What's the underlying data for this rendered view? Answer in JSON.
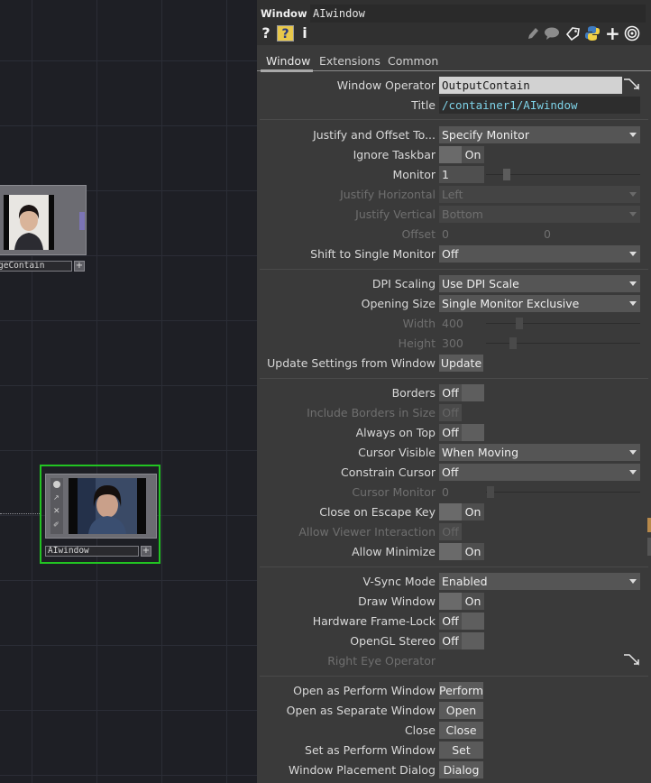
{
  "network": {
    "node_left_label": "geContain",
    "node_ai_label": "AIwindow",
    "plus_glyph": "+"
  },
  "header": {
    "op_type": "Window",
    "op_name": "AIwindow",
    "icons": [
      "help-icon",
      "python-help-icon",
      "info-icon",
      "edit-icon",
      "comment-icon",
      "tag-icon",
      "python-icon",
      "add-icon",
      "target-icon"
    ]
  },
  "tabs": [
    "Window",
    "Extensions",
    "Common"
  ],
  "params": {
    "window_operator": {
      "label": "Window Operator",
      "value": "OutputContain"
    },
    "title": {
      "label": "Title",
      "value": "/container1/AIwindow"
    },
    "justify_offset": {
      "label": "Justify and Offset To...",
      "value": "Specify Monitor"
    },
    "ignore_taskbar": {
      "label": "Ignore Taskbar",
      "value": "On"
    },
    "monitor": {
      "label": "Monitor",
      "value": "1"
    },
    "justify_h": {
      "label": "Justify Horizontal",
      "value": "Left"
    },
    "justify_v": {
      "label": "Justify Vertical",
      "value": "Bottom"
    },
    "offset": {
      "label": "Offset",
      "x": "0",
      "y": "0"
    },
    "shift_single": {
      "label": "Shift to Single Monitor",
      "value": "Off"
    },
    "dpi_scaling": {
      "label": "DPI Scaling",
      "value": "Use DPI Scale"
    },
    "opening_size": {
      "label": "Opening Size",
      "value": "Single Monitor Exclusive"
    },
    "width": {
      "label": "Width",
      "value": "400"
    },
    "height": {
      "label": "Height",
      "value": "300"
    },
    "update_settings": {
      "label": "Update Settings from Window",
      "button": "Update"
    },
    "borders": {
      "label": "Borders",
      "value": "Off"
    },
    "include_borders": {
      "label": "Include Borders in Size",
      "value": "Off"
    },
    "always_on_top": {
      "label": "Always on Top",
      "value": "Off"
    },
    "cursor_visible": {
      "label": "Cursor Visible",
      "value": "When Moving"
    },
    "constrain_cursor": {
      "label": "Constrain Cursor",
      "value": "Off"
    },
    "cursor_monitor": {
      "label": "Cursor Monitor",
      "value": "0"
    },
    "close_escape": {
      "label": "Close on Escape Key",
      "value": "On"
    },
    "allow_viewer": {
      "label": "Allow Viewer Interaction",
      "value": "Off"
    },
    "allow_minimize": {
      "label": "Allow Minimize",
      "value": "On"
    },
    "vsync": {
      "label": "V-Sync Mode",
      "value": "Enabled"
    },
    "draw_window": {
      "label": "Draw Window",
      "value": "On"
    },
    "hw_framelock": {
      "label": "Hardware Frame-Lock",
      "value": "Off"
    },
    "opengl_stereo": {
      "label": "OpenGL Stereo",
      "value": "Off"
    },
    "right_eye": {
      "label": "Right Eye Operator"
    },
    "open_perform": {
      "label": "Open as Perform Window",
      "button": "Perform"
    },
    "open_separate": {
      "label": "Open as Separate Window",
      "button": "Open"
    },
    "close": {
      "label": "Close",
      "button": "Close"
    },
    "set_perform": {
      "label": "Set as Perform Window",
      "button": "Set"
    },
    "placement_dialog": {
      "label": "Window Placement Dialog",
      "button": "Dialog"
    }
  },
  "colors": {
    "panel_bg": "#3a3a3a",
    "title_text": "#7ed3e8",
    "selected_node": "#22c422"
  }
}
